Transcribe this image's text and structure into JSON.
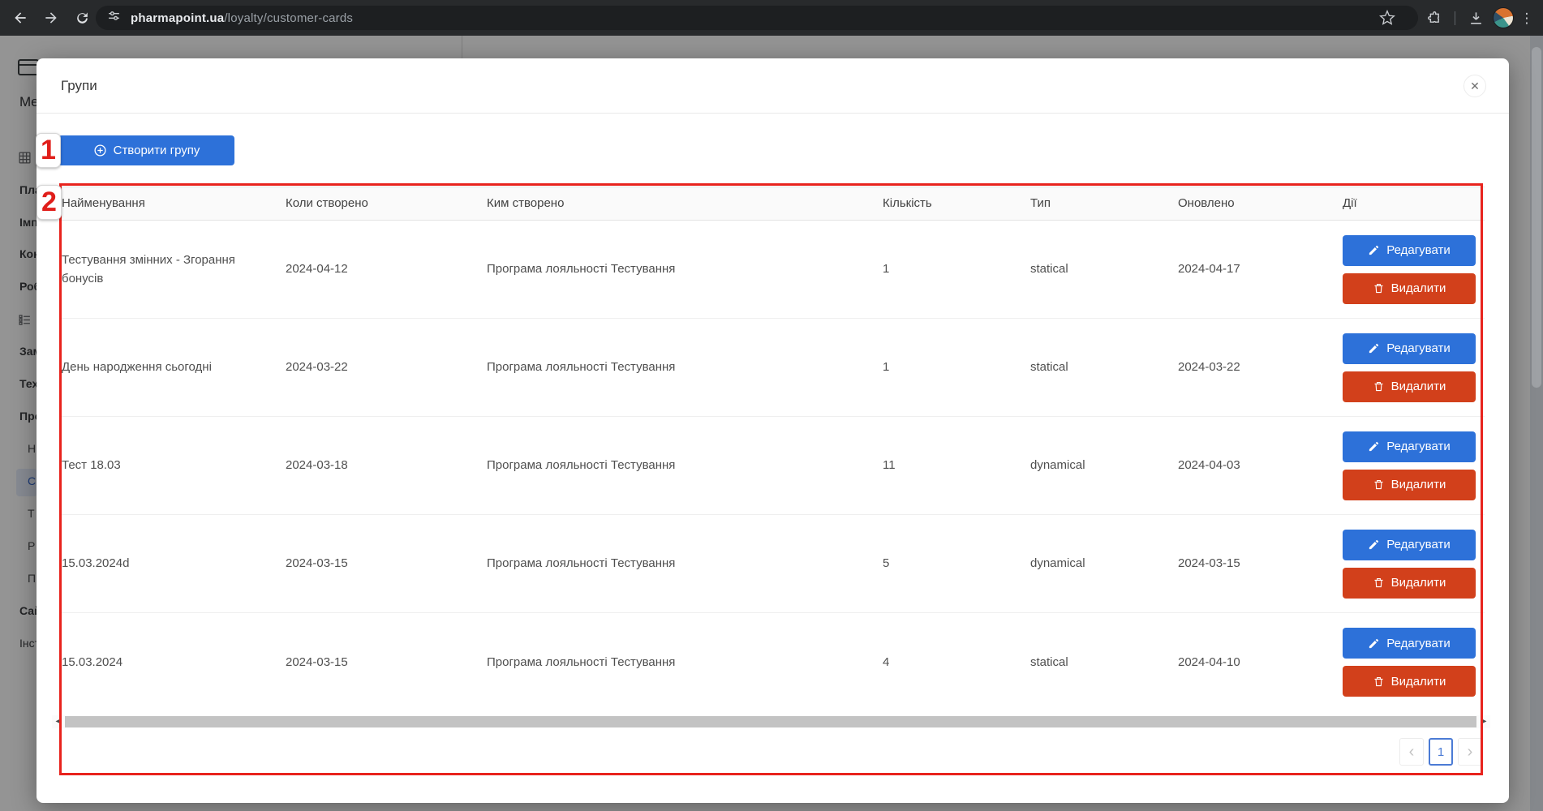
{
  "browser": {
    "url_domain": "pharmapoint.ua",
    "url_path": "/loyalty/customer-cards"
  },
  "sidebar": {
    "items": [
      {
        "label": "Me"
      },
      {
        "label": "Пла"
      },
      {
        "label": "Імп"
      },
      {
        "label": "Кон"
      },
      {
        "label": "Роб"
      },
      {
        "label": "Зам"
      },
      {
        "label": "Тех"
      },
      {
        "label": "Про"
      },
      {
        "label": "Н"
      },
      {
        "label": "С"
      },
      {
        "label": "Т"
      },
      {
        "label": "Р"
      },
      {
        "label": "П"
      },
      {
        "label": "Сай"
      },
      {
        "label": "Інст"
      }
    ]
  },
  "annotations": {
    "marker1": "1",
    "marker2": "2"
  },
  "modal": {
    "title": "Групи",
    "close_label": "✕",
    "create_button_label": "Створити групу",
    "table": {
      "columns": [
        "Найменування",
        "Коли створено",
        "Ким створено",
        "Кількість",
        "Тип",
        "Оновлено",
        "Дії"
      ],
      "edit_label": "Редагувати",
      "delete_label": "Видалити",
      "rows": [
        {
          "name": "Тестування змінних - Згорання бонусів",
          "created": "2024-04-12",
          "creator": "Програма лояльності Тестування",
          "count": "1",
          "type": "statical",
          "updated": "2024-04-17"
        },
        {
          "name": "День народження сьогодні",
          "created": "2024-03-22",
          "creator": "Програма лояльності Тестування",
          "count": "1",
          "type": "statical",
          "updated": "2024-03-22"
        },
        {
          "name": "Тест 18.03",
          "created": "2024-03-18",
          "creator": "Програма лояльності Тестування",
          "count": "11",
          "type": "dynamical",
          "updated": "2024-04-03"
        },
        {
          "name": "15.03.2024d",
          "created": "2024-03-15",
          "creator": "Програма лояльності Тестування",
          "count": "5",
          "type": "dynamical",
          "updated": "2024-03-15"
        },
        {
          "name": "15.03.2024",
          "created": "2024-03-15",
          "creator": "Програма лояльності Тестування",
          "count": "4",
          "type": "statical",
          "updated": "2024-04-10"
        }
      ]
    },
    "pagination": {
      "prev": "‹",
      "page": "1",
      "next": "›"
    },
    "scrollbar": {
      "left_arrow": "◂",
      "right_arrow": "▸"
    }
  },
  "colors": {
    "accent_blue": "#2d71d9",
    "danger_red": "#d2401b",
    "annotation_red": "#e8231d"
  }
}
